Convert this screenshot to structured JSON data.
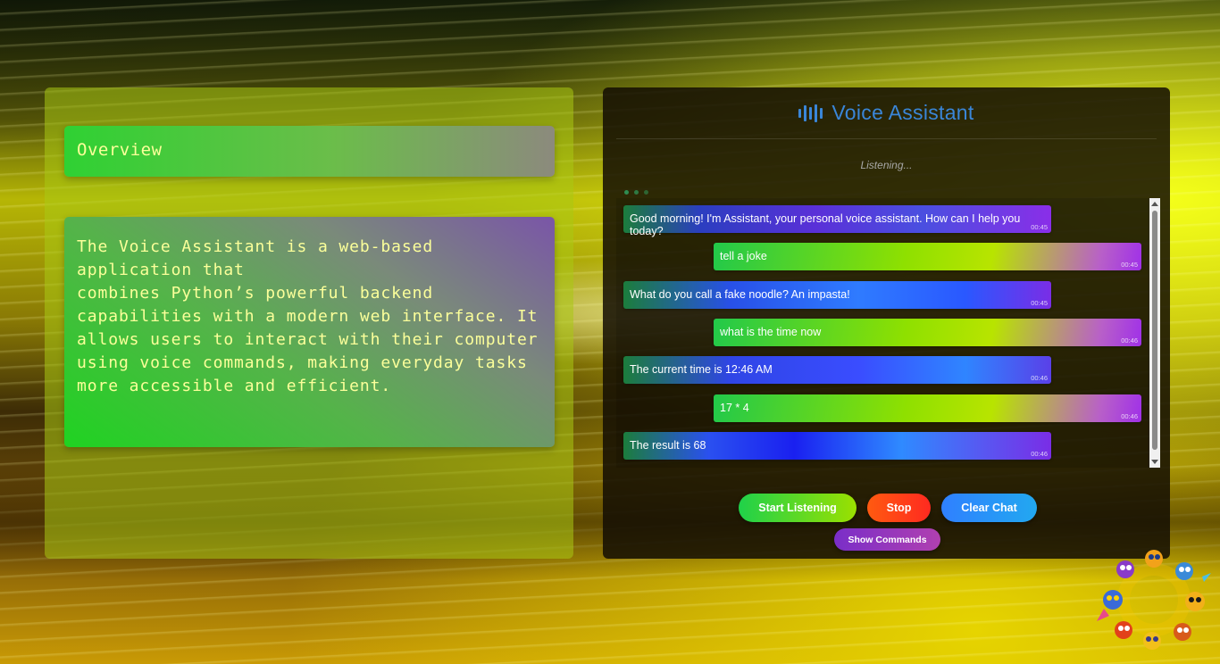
{
  "overview": {
    "title": "Overview",
    "description": "The Voice Assistant is a web-based application that\ncombines Python’s powerful backend capabilities with a modern web interface. It allows users to interact with their computer using voice commands, making everyday tasks more accessible and efficient."
  },
  "assistant": {
    "title": "Voice Assistant",
    "icon": "sound-wave-icon",
    "status": "Listening...",
    "messages": [
      {
        "sender": "bot",
        "text": "Good morning! I'm Assistant, your personal voice assistant. How can I help you today?",
        "time": "00:45"
      },
      {
        "sender": "user",
        "text": "tell a joke",
        "time": "00:45"
      },
      {
        "sender": "bot",
        "text": "What do you call a fake noodle? An impasta!",
        "time": "00:45"
      },
      {
        "sender": "user",
        "text": "what is the time now",
        "time": "00:46"
      },
      {
        "sender": "bot",
        "text": "The current time is 12:46 AM",
        "time": "00:46"
      },
      {
        "sender": "user",
        "text": "17 * 4",
        "time": "00:46"
      },
      {
        "sender": "bot",
        "text": "The result is 68",
        "time": "00:46"
      }
    ],
    "buttons": {
      "start": "Start Listening",
      "stop": "Stop",
      "clear": "Clear Chat",
      "commands": "Show Commands"
    }
  },
  "colors": {
    "accent": "#3a86d8",
    "text_on_cards": "#fbff9a",
    "start_button": "#1fd14a",
    "stop_button": "#ff3a1a",
    "clear_button": "#2f80ff",
    "commands_button": "#8a34c0"
  }
}
